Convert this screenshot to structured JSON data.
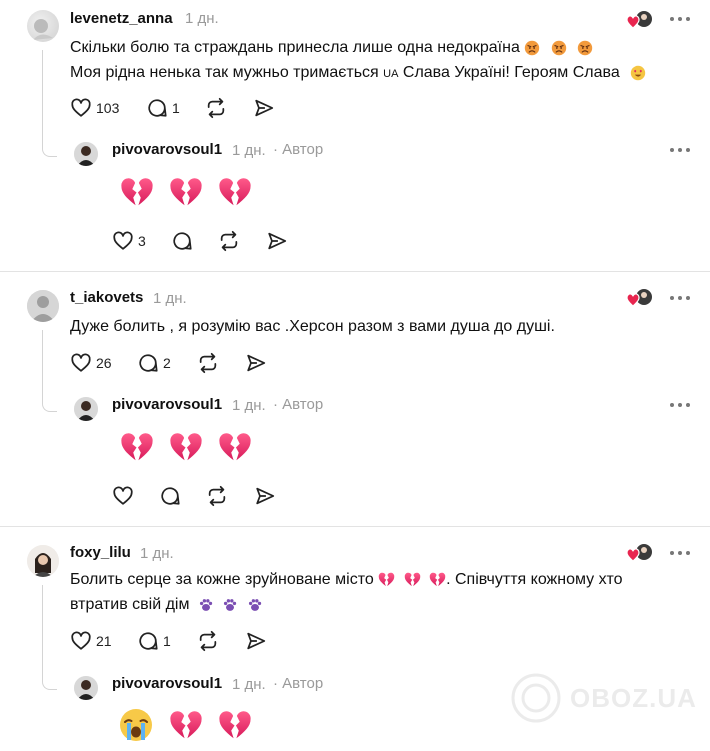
{
  "comments": [
    {
      "username": "levenetz_anna",
      "time": "1 дн.",
      "text_line1": "Скільки болю та страждань принесла лише одна недокраїна",
      "text_line2_a": "Моя рідна ненька так мужньо тримається ",
      "text_line2_flag": "UA",
      "text_line2_b": " Слава Україні! Героям Слава",
      "likes": "103",
      "replies": "1",
      "reply": {
        "username": "pivovarovsoul1",
        "time": "1 дн.",
        "author": "· Автор",
        "likes": "3"
      }
    },
    {
      "username": "t_iakovets",
      "time": "1 дн.",
      "text_line1": "Дуже болить , я розумію вас .Херсон разом з вами душа до душі.",
      "likes": "26",
      "replies": "2",
      "reply": {
        "username": "pivovarovsoul1",
        "time": "1 дн.",
        "author": "· Автор",
        "likes": ""
      }
    },
    {
      "username": "foxy_lilu",
      "time": "1 дн.",
      "text_line1": "Болить серце за кожне зруйноване місто",
      "text_line1_b": ". Співчуття кожному хто",
      "text_line2": "втратив свій дім",
      "likes": "21",
      "replies": "1",
      "reply": {
        "username": "pivovarovsoul1",
        "time": "1 дн.",
        "author": "· Автор"
      }
    }
  ],
  "watermark": "OBOZ.UA",
  "colors": {
    "heart": "#e8254f",
    "broken_heart": "#f0307a",
    "text": "#111111",
    "meta": "#9a9a9a"
  },
  "icons": [
    "heart-icon",
    "comment-icon",
    "repost-icon",
    "share-icon",
    "more-icon",
    "broken-heart-icon",
    "angry-face-icon",
    "heart-eyes-face-icon",
    "purple-paw-icon",
    "crying-face-icon"
  ]
}
